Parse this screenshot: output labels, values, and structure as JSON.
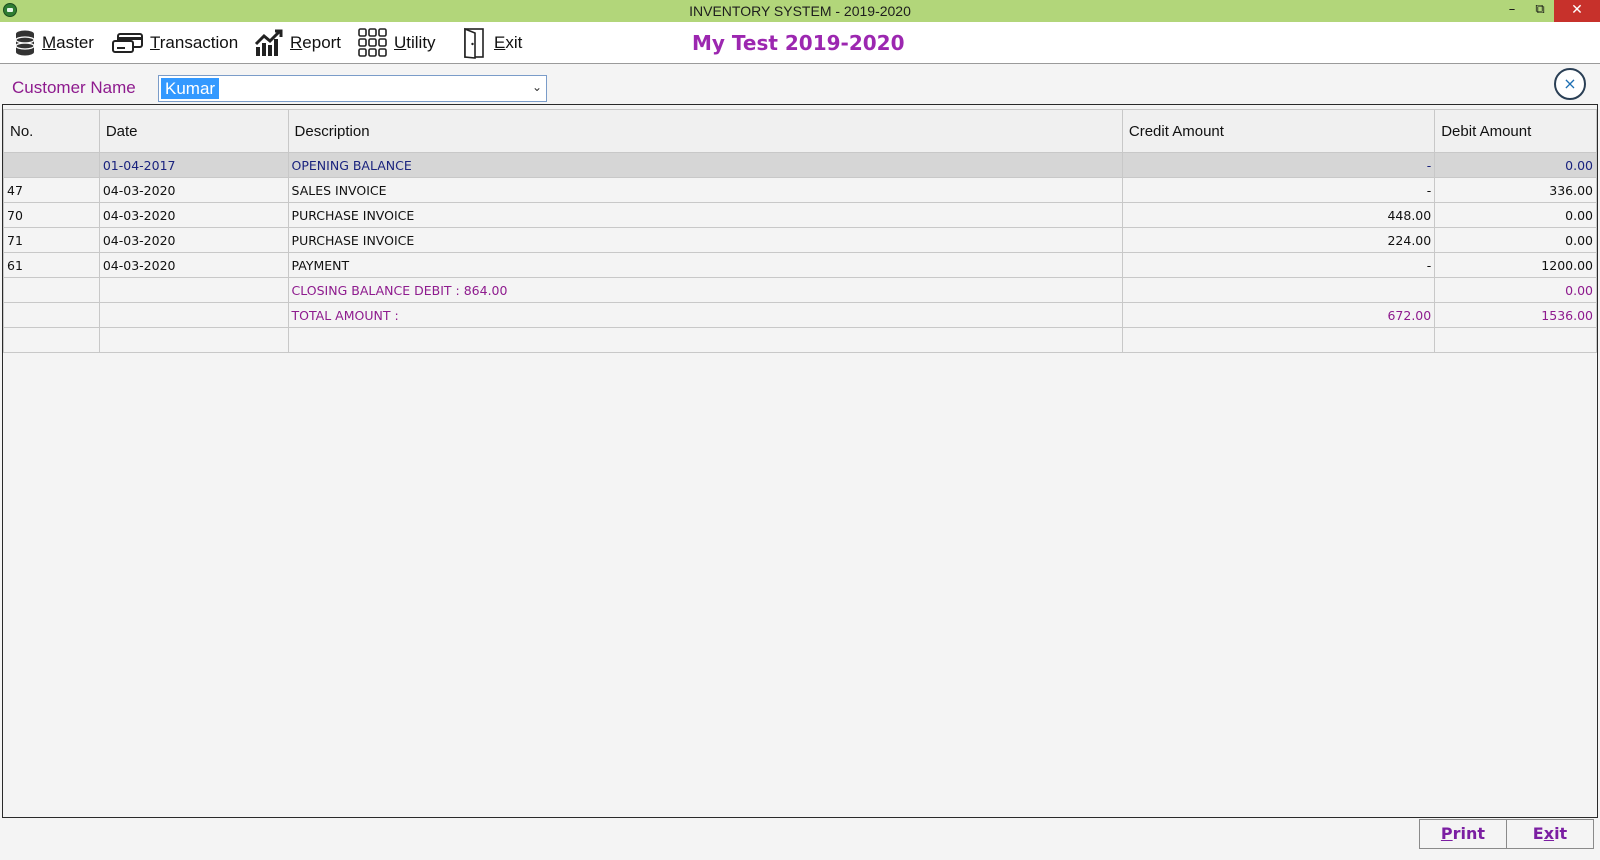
{
  "window": {
    "title": "INVENTORY SYSTEM - 2019-2020",
    "minimize": "–",
    "maximize": "⧉",
    "close": "✕"
  },
  "menu": [
    {
      "label": "Master",
      "icon": "database-icon"
    },
    {
      "label": "Transaction",
      "icon": "credit-card-icon"
    },
    {
      "label": "Report",
      "icon": "chart-icon"
    },
    {
      "label": "Utility",
      "icon": "grid-icon"
    },
    {
      "label": "Exit",
      "icon": "door-icon"
    }
  ],
  "company": "My Test 2019-2020",
  "customer": {
    "label": "Customer Name",
    "value": "Kumar",
    "arrow": "⌄",
    "close_glyph": "×"
  },
  "table": {
    "columns": [
      "No.",
      "Date",
      "Description",
      "Credit Amount",
      "Debit Amount"
    ],
    "rows": [
      {
        "no": "",
        "date": "01-04-2017",
        "desc": "OPENING BALANCE",
        "credit": "-",
        "debit": "0.00",
        "style": "open"
      },
      {
        "no": "47",
        "date": "04-03-2020",
        "desc": "SALES INVOICE",
        "credit": "-",
        "debit": "336.00",
        "style": "normal"
      },
      {
        "no": "70",
        "date": "04-03-2020",
        "desc": "PURCHASE INVOICE",
        "credit": "448.00",
        "debit": "0.00",
        "style": "normal"
      },
      {
        "no": "71",
        "date": "04-03-2020",
        "desc": "PURCHASE INVOICE",
        "credit": "224.00",
        "debit": "0.00",
        "style": "normal"
      },
      {
        "no": "61",
        "date": "04-03-2020",
        "desc": "PAYMENT",
        "credit": "-",
        "debit": "1200.00",
        "style": "normal"
      },
      {
        "no": "",
        "date": "",
        "desc": "CLOSING BALANCE DEBIT : 864.00",
        "credit": "",
        "debit": "0.00",
        "style": "purple"
      },
      {
        "no": "",
        "date": "",
        "desc": "TOTAL AMOUNT :",
        "credit": "672.00",
        "debit": "1536.00",
        "style": "purple"
      },
      {
        "no": "",
        "date": "",
        "desc": "",
        "credit": "",
        "debit": "",
        "style": "normal"
      }
    ]
  },
  "buttons": {
    "print": {
      "first": "P",
      "rest": "rint"
    },
    "exit": {
      "first": "E",
      "under": "x",
      "rest": "it"
    }
  },
  "colors": {
    "titlebar": "#b2d67a",
    "accent_purple": "#9c27b0",
    "label_purple": "#8e1b8e",
    "opening_text": "#1a237e",
    "selection": "#3399ff"
  }
}
